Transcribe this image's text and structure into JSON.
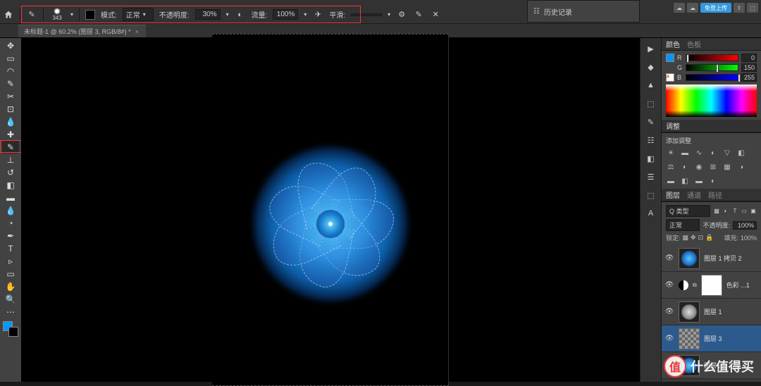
{
  "menubar": {},
  "options": {
    "brush_size": "343",
    "mode_label": "模式:",
    "mode_value": "正常",
    "opacity_label": "不透明度:",
    "opacity_value": "30%",
    "flow_label": "流量:",
    "flow_value": "100%",
    "smoothing_label": "平滑:"
  },
  "doc_tab": {
    "title": "未标题-1 @ 60.2% (图层 3, RGB/8#) *"
  },
  "history_panel": {
    "title": "历史记录"
  },
  "cloud": {
    "label": "免登上传"
  },
  "color_panel": {
    "tab1": "颜色",
    "tab2": "色板",
    "r_label": "R",
    "r_val": "0",
    "g_label": "G",
    "g_val": "150",
    "b_label": "B",
    "b_val": "255"
  },
  "adjust_panel": {
    "header": "调整",
    "title": "添加调整"
  },
  "layers_panel": {
    "tab1": "图层",
    "tab2": "通道",
    "tab3": "路径",
    "kind_label": "Q 类型",
    "blend_mode": "正常",
    "opacity_label": "不透明度:",
    "opacity_value": "100%",
    "lock_label": "锁定:",
    "fill_label": "填充:",
    "fill_value": "100%",
    "layers": [
      {
        "name": "图层 1 拷贝 2",
        "type": "fan-blue",
        "selected": false,
        "visible": true
      },
      {
        "name": "色彩 ...1",
        "type": "adjustment",
        "selected": false,
        "visible": true
      },
      {
        "name": "图层 1",
        "type": "fan-bw",
        "selected": false,
        "visible": true
      },
      {
        "name": "图层 3",
        "type": "checker",
        "selected": true,
        "visible": true
      },
      {
        "name": "图层 ...",
        "type": "fan-blue",
        "selected": false,
        "visible": true
      }
    ]
  },
  "watermark": {
    "text": "什么值得买",
    "badge": "值"
  }
}
